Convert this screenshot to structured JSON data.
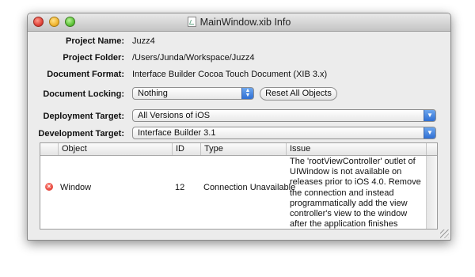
{
  "window": {
    "title": "MainWindow.xib Info"
  },
  "fields": {
    "project_name_label": "Project Name:",
    "project_name_value": "Juzz4",
    "project_folder_label": "Project Folder:",
    "project_folder_value": "/Users/Junda/Workspace/Juzz4",
    "document_format_label": "Document Format:",
    "document_format_value": "Interface Builder Cocoa Touch Document (XIB 3.x)",
    "document_locking_label": "Document Locking:",
    "document_locking_value": "Nothing",
    "reset_button_label": "Reset All Objects",
    "deployment_target_label": "Deployment Target:",
    "deployment_target_value": "All Versions of iOS",
    "development_target_label": "Development Target:",
    "development_target_value": "Interface Builder 3.1"
  },
  "table": {
    "columns": [
      "Object",
      "ID",
      "Type",
      "Issue"
    ],
    "rows": [
      {
        "status_icon": "error-icon",
        "object": "Window",
        "id": "12",
        "type": "Connection Unavailable",
        "issue": "The 'rootViewController' outlet of UIWindow is not available on releases prior to iOS 4.0. Remove the connection and instead programmatically add the view controller's view to the window after the application finishes launching."
      }
    ]
  },
  "colors": {
    "accent": "#3a7be0",
    "error": "#d8261c"
  }
}
